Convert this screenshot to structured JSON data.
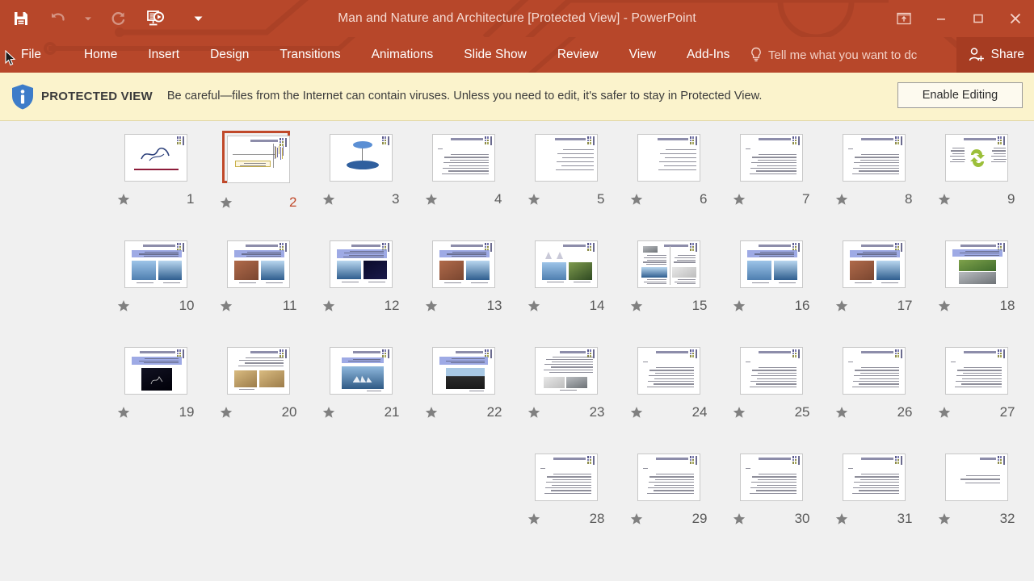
{
  "window": {
    "title": "Man and Nature and Architecture [Protected View] - PowerPoint",
    "accent_color": "#b7472a",
    "share_bg": "#a63c22"
  },
  "quick_access": [
    {
      "name": "save",
      "icon": "floppy-disk-icon",
      "enabled": true
    },
    {
      "name": "undo",
      "icon": "undo-arrow-icon",
      "enabled": false
    },
    {
      "name": "undo-dropdown",
      "icon": "chevron-down-icon",
      "enabled": false
    },
    {
      "name": "redo",
      "icon": "redo-circular-arrow-icon",
      "enabled": false
    },
    {
      "name": "start-from-beginning",
      "icon": "presentation-play-icon",
      "enabled": true
    },
    {
      "name": "customize-quick-access-toolbar",
      "icon": "chevron-down-icon",
      "enabled": true
    }
  ],
  "window_controls": [
    {
      "name": "ribbon-display-options",
      "icon": "ribbon-display-icon"
    },
    {
      "name": "minimize",
      "icon": "minimize-icon"
    },
    {
      "name": "maximize",
      "icon": "maximize-icon"
    },
    {
      "name": "close",
      "icon": "close-icon"
    }
  ],
  "ribbon": {
    "tabs": [
      {
        "label": "File",
        "active": false
      },
      {
        "label": "Home",
        "active": false
      },
      {
        "label": "Insert",
        "active": false
      },
      {
        "label": "Design",
        "active": false
      },
      {
        "label": "Transitions",
        "active": false
      },
      {
        "label": "Animations",
        "active": false
      },
      {
        "label": "Slide Show",
        "active": false
      },
      {
        "label": "Review",
        "active": false
      },
      {
        "label": "View",
        "active": false
      },
      {
        "label": "Add-Ins",
        "active": false
      }
    ],
    "tell_me": {
      "placeholder": "Tell me what you want to dc",
      "icon": "lightbulb-icon"
    },
    "share": {
      "label": "Share",
      "icon": "person-add-icon"
    }
  },
  "protected_view": {
    "icon": "info-shield-icon",
    "label": "PROTECTED VIEW",
    "message": "Be careful—files from the Internet can contain viruses. Unless you need to edit, it's safer to stay in Protected View.",
    "button_label": "Enable Editing",
    "bar_color": "#fbf3cc"
  },
  "slide_sorter": {
    "selected_slide": 2,
    "total_slides": 32,
    "direction": "rtl",
    "rows": [
      {
        "numbers": [
          9,
          8,
          7,
          6,
          5,
          4,
          3,
          2,
          1
        ],
        "pad_left": 0
      },
      {
        "numbers": [
          18,
          17,
          16,
          15,
          14,
          13,
          12,
          11,
          10
        ],
        "pad_left": 0
      },
      {
        "numbers": [
          27,
          26,
          25,
          24,
          23,
          22,
          21,
          20,
          19
        ],
        "pad_left": 0
      },
      {
        "numbers": [
          32,
          31,
          30,
          29,
          28
        ],
        "pad_left": 4
      }
    ],
    "slides": {
      "1": {
        "layout": "title-calligraphy"
      },
      "2": {
        "layout": "title-chart"
      },
      "3": {
        "layout": "diagram-ovals"
      },
      "4": {
        "layout": "text-block"
      },
      "5": {
        "layout": "bullets"
      },
      "6": {
        "layout": "bullets"
      },
      "7": {
        "layout": "text-block"
      },
      "8": {
        "layout": "text-block"
      },
      "9": {
        "layout": "diagram-cycle"
      },
      "10": {
        "layout": "two-photos"
      },
      "11": {
        "layout": "two-photos"
      },
      "12": {
        "layout": "two-photos-dark"
      },
      "13": {
        "layout": "two-photos"
      },
      "14": {
        "layout": "two-photos-charts"
      },
      "15": {
        "layout": "two-column-compare"
      },
      "16": {
        "layout": "two-photos"
      },
      "17": {
        "layout": "two-photos"
      },
      "18": {
        "layout": "stacked-photos"
      },
      "19": {
        "layout": "black-photo"
      },
      "20": {
        "layout": "two-photos-text"
      },
      "21": {
        "layout": "single-photo"
      },
      "22": {
        "layout": "single-photo-wide"
      },
      "23": {
        "layout": "text-two-photos"
      },
      "24": {
        "layout": "text-block"
      },
      "25": {
        "layout": "text-block"
      },
      "26": {
        "layout": "text-block"
      },
      "27": {
        "layout": "text-block"
      },
      "28": {
        "layout": "text-block"
      },
      "29": {
        "layout": "text-block"
      },
      "30": {
        "layout": "text-block"
      },
      "31": {
        "layout": "text-block"
      },
      "32": {
        "layout": "text-short"
      }
    },
    "star_icon": "star-icon"
  }
}
